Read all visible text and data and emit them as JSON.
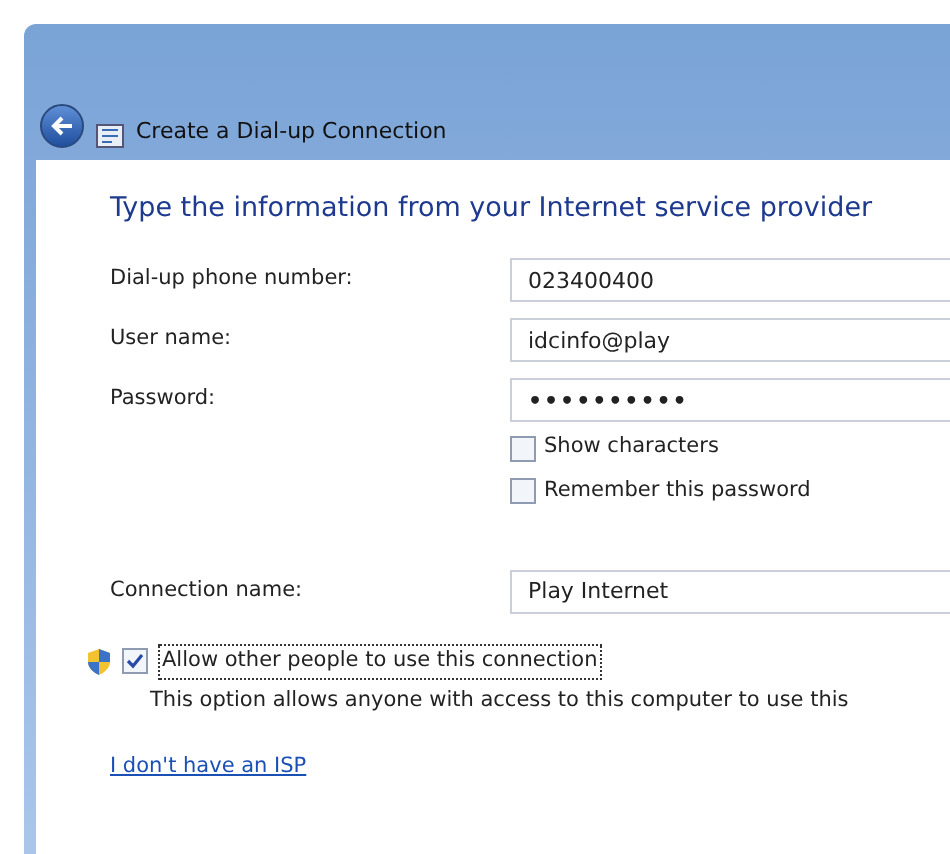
{
  "window": {
    "title": "Create a Dial-up Connection"
  },
  "heading": "Type the information from your Internet service provider",
  "fields": [
    {
      "label": "Dial-up phone number:",
      "value": "023400400",
      "kind": "text"
    },
    {
      "label": "User name:",
      "value": "idcinfo@play",
      "kind": "text"
    },
    {
      "label": "Password:",
      "value": "••••••••••",
      "kind": "password"
    }
  ],
  "password_options": [
    {
      "label": "Show characters",
      "checked": false
    },
    {
      "label": "Remember this password",
      "checked": false
    }
  ],
  "connection_name": {
    "label": "Connection name:",
    "value": "Play Internet"
  },
  "allow_others": {
    "label": "Allow other people to use this connection",
    "checked": true,
    "description": "This option allows anyone with access to this computer to use this"
  },
  "link": "I don't have an ISP"
}
